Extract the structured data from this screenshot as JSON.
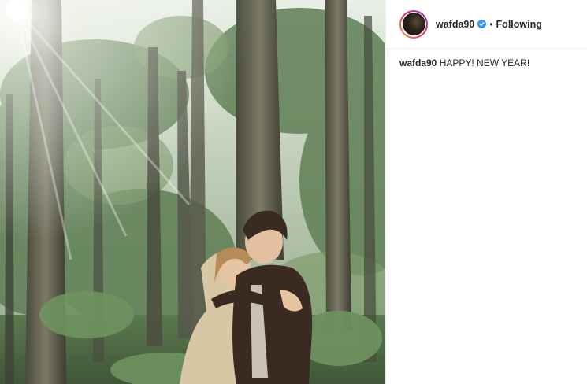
{
  "post": {
    "image": {
      "description_icon": "photo"
    },
    "header": {
      "username": "wafda90",
      "separator": "•",
      "follow_label": "Following"
    },
    "caption": {
      "username": "wafda90",
      "text": "HAPPY! NEW YEAR!"
    }
  },
  "colors": {
    "verified_blue": "#3897f0",
    "text": "#262626",
    "border": "#efefef"
  }
}
